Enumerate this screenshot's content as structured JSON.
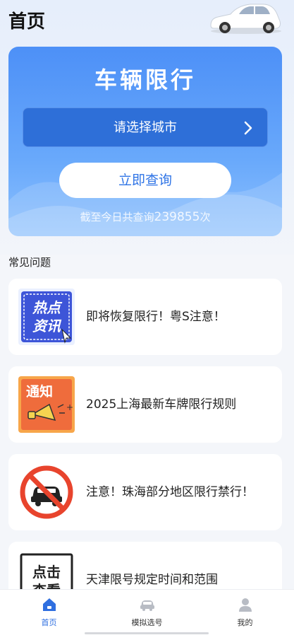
{
  "header": {
    "title": "首页"
  },
  "hero": {
    "title": "车辆限行",
    "city_select_placeholder": "请选择城市",
    "query_button": "立即查询",
    "count_prefix": "截至今日共查询",
    "count_value": "239855",
    "count_suffix": "次"
  },
  "faq": {
    "section_title": "常见问题",
    "items": [
      {
        "thumb_text_1": "热点",
        "thumb_text_2": "资讯",
        "text": "即将恢复限行！粤S注意！",
        "icon": "hot-news-icon"
      },
      {
        "thumb_text": "通知",
        "text": "2025上海最新车牌限行规则",
        "icon": "notice-megaphone-icon"
      },
      {
        "text": "注意！珠海部分地区限行禁行！",
        "icon": "no-car-icon"
      },
      {
        "thumb_text_1": "点击",
        "thumb_text_2": "查看",
        "text": "天津限号规定时间和范围",
        "icon": "click-view-icon"
      }
    ]
  },
  "tabbar": {
    "items": [
      {
        "label": "首页",
        "icon": "home-icon",
        "active": true
      },
      {
        "label": "模拟选号",
        "icon": "car-icon",
        "active": false
      },
      {
        "label": "我的",
        "icon": "user-icon",
        "active": false
      }
    ]
  },
  "colors": {
    "primary": "#2f74e6",
    "hero_gradient_top": "#4d90f7",
    "select_bg": "#2e6fd8"
  }
}
